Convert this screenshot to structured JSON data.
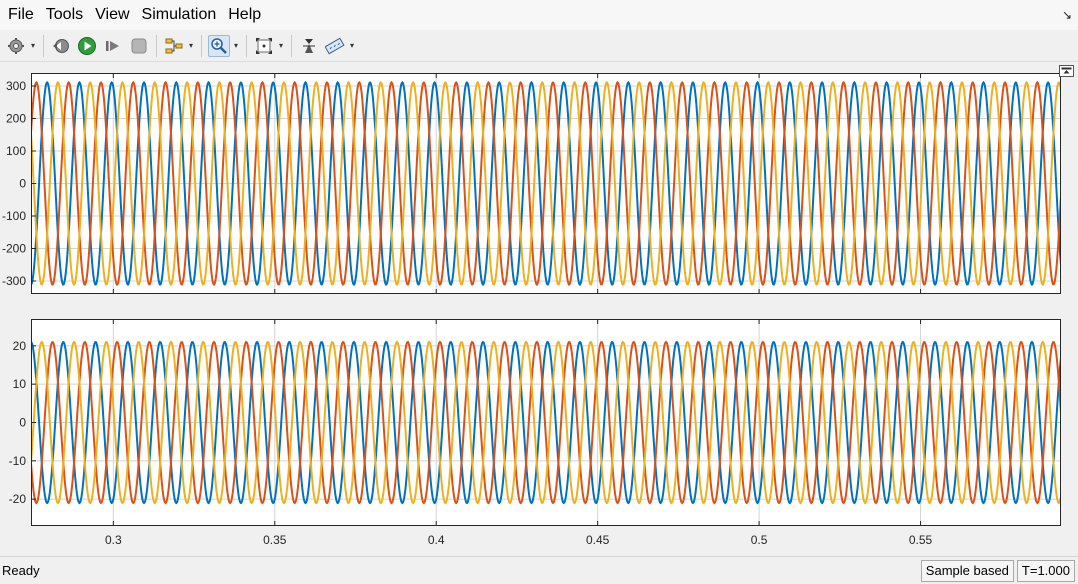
{
  "menu": {
    "items": [
      "File",
      "Tools",
      "View",
      "Simulation",
      "Help"
    ]
  },
  "toolbar": {
    "buttons": [
      "settings-icon",
      "step-back-icon",
      "run-icon",
      "step-forward-icon",
      "stop-icon",
      "highlight-icon",
      "zoom-in-icon",
      "fit-to-view-icon",
      "autoscale-icon",
      "measurements-icon"
    ],
    "active": "zoom-in-icon"
  },
  "status": {
    "text": "Ready",
    "mode": "Sample based",
    "time": "T=1.000"
  },
  "colors": {
    "series_blue": "#0072BD",
    "series_orange": "#D95319",
    "series_yellow": "#EDB120",
    "axes_background": "#ffffff",
    "grid": "#d4d4d4"
  },
  "chart_data": [
    {
      "type": "line",
      "title": "",
      "xlabel": "",
      "ylabel": "",
      "xlim": [
        0.2745,
        0.5935
      ],
      "ylim": [
        -340,
        340
      ],
      "yticks": [
        -300,
        -200,
        -100,
        0,
        100,
        200,
        300
      ],
      "xticks": [
        0.3,
        0.35,
        0.4,
        0.45,
        0.5,
        0.55
      ],
      "grid": true,
      "legend": "none",
      "frequency_hz": 100,
      "series": [
        {
          "amplitude": 311,
          "phase_deg": 270,
          "color": "#0072BD"
        },
        {
          "amplitude": 311,
          "phase_deg": 30,
          "color": "#D95319"
        },
        {
          "amplitude": 311,
          "phase_deg": 150,
          "color": "#EDB120"
        }
      ]
    },
    {
      "type": "line",
      "title": "",
      "xlabel": "",
      "ylabel": "",
      "xlim": [
        0.2745,
        0.5935
      ],
      "ylim": [
        -27,
        27
      ],
      "yticks": [
        -20,
        -10,
        0,
        10,
        20
      ],
      "xticks": [
        0.3,
        0.35,
        0.4,
        0.45,
        0.5,
        0.55
      ],
      "xticklabels": [
        "0.3",
        "0.35",
        "0.4",
        "0.45",
        "0.5",
        "0.55"
      ],
      "grid": true,
      "legend": "none",
      "frequency_hz": 100,
      "series": [
        {
          "amplitude": 21,
          "phase_deg": 90,
          "color": "#0072BD"
        },
        {
          "amplitude": 21,
          "phase_deg": 210,
          "color": "#D95319"
        },
        {
          "amplitude": 21,
          "phase_deg": 330,
          "color": "#EDB120"
        }
      ]
    }
  ]
}
